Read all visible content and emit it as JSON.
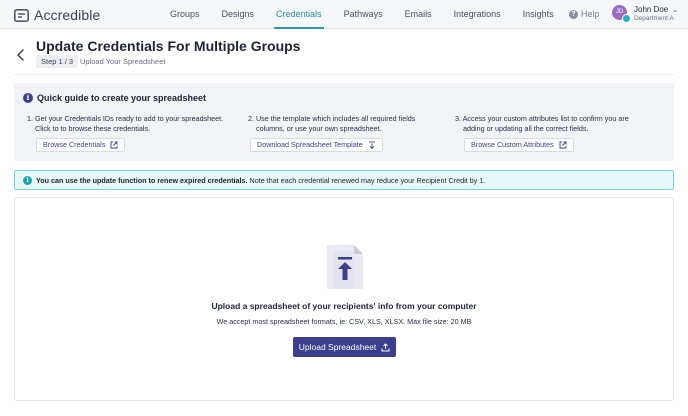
{
  "app": {
    "name": "Accredible"
  },
  "nav": {
    "items": [
      "Groups",
      "Designs",
      "Credentials",
      "Pathways",
      "Emails",
      "Integrations",
      "Insights"
    ],
    "active": "Credentials",
    "help_label": "Help"
  },
  "user": {
    "initials": "JD",
    "name": "John Doe",
    "department": "Department A"
  },
  "header": {
    "title": "Update Credentials For Multiple Groups",
    "step_badge": "Step 1 / 3",
    "step_label": "Upload Your Spreadsheet"
  },
  "guide": {
    "title": "Quick guide to create your spreadsheet",
    "steps": [
      {
        "line1": "1. Get your Credentials IDs ready to add to your spreadsheet.",
        "line2": "Click to to browse these credentials.",
        "button": "Browse Credentials",
        "icon": "external-link-icon"
      },
      {
        "line1": "2. Use the template which includes all required fields",
        "line2": "columns, or use your own spreadsheet.",
        "button": "Download Spreadsheet Template",
        "icon": "download-icon"
      },
      {
        "line1": "3. Access your custom attributes list to confirm you are",
        "line2": "adding or updating all the correct fields.",
        "button": "Browse Custom Attributes",
        "icon": "external-link-icon"
      }
    ]
  },
  "info": {
    "bold": "You can use the update function to renew expired credentials.",
    "text": " Note that each credential renewed may reduce your Recipient Credit by 1."
  },
  "upload": {
    "title": "Upload a spreadsheet of your recipients' info from your computer",
    "subtitle": "We accept most spreadsheet formats, ie: CSV, XLS, XLSX. Max file size: 20 MB",
    "button": "Upload Spreadsheet"
  },
  "colors": {
    "primary": "#3b3f8c",
    "accent": "#2a9aa6",
    "info_bg": "#e6f7f8"
  }
}
